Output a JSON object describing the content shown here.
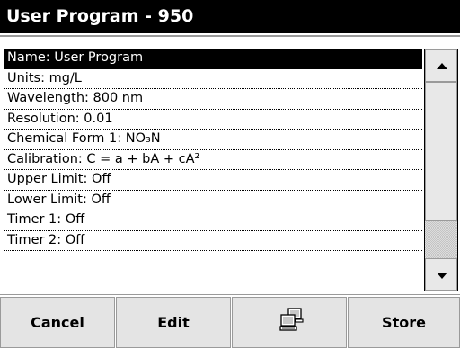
{
  "window": {
    "title": "User Program - 950"
  },
  "parameters": [
    {
      "label": "Name: User Program",
      "selected": true
    },
    {
      "label": "Units: mg/L",
      "selected": false
    },
    {
      "label": "Wavelength: 800 nm",
      "selected": false
    },
    {
      "label": "Resolution: 0.01",
      "selected": false
    },
    {
      "label": "Chemical Form 1: NO₃N",
      "selected": false
    },
    {
      "label": "Calibration: C = a + bA + cA²",
      "selected": false
    },
    {
      "label": "Upper Limit: Off",
      "selected": false
    },
    {
      "label": "Lower Limit: Off",
      "selected": false
    },
    {
      "label": "Timer 1: Off",
      "selected": false
    },
    {
      "label": "Timer 2: Off",
      "selected": false
    }
  ],
  "scrollbar": {
    "up_icon": "arrow-up-icon",
    "down_icon": "arrow-down-icon"
  },
  "buttons": {
    "cancel_label": "Cancel",
    "edit_label": "Edit",
    "pc_icon": "computer-icon",
    "store_label": "Store"
  },
  "colors": {
    "title_background": "#000000",
    "title_text": "#ffffff",
    "selected_row_background": "#000000",
    "button_background": "#e4e4e4"
  }
}
